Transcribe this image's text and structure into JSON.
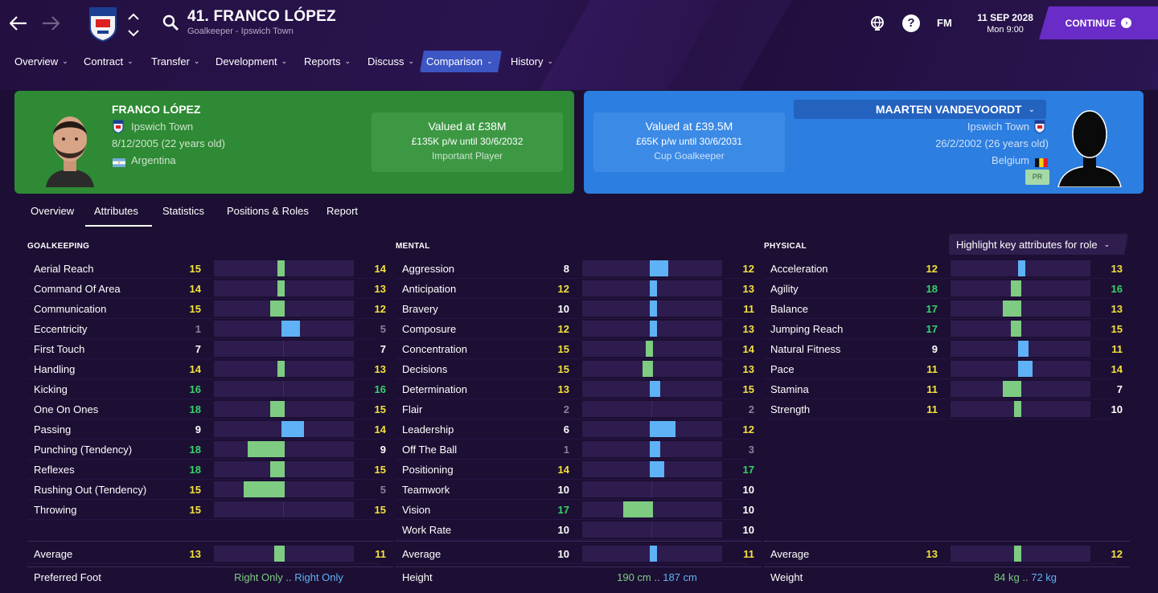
{
  "header": {
    "title": "41. FRANCO LÓPEZ",
    "subtitle": "Goalkeeper - Ipswich Town",
    "fm_label": "FM",
    "date": "11 SEP 2028",
    "time": "Mon 9:00",
    "continue_label": "CONTINUE"
  },
  "menu": [
    {
      "label": "Overview"
    },
    {
      "label": "Contract"
    },
    {
      "label": "Transfer"
    },
    {
      "label": "Development"
    },
    {
      "label": "Reports"
    },
    {
      "label": "Discuss"
    },
    {
      "label": "Comparison",
      "active": true
    },
    {
      "label": "History"
    }
  ],
  "player_left": {
    "name": "FRANCO LÓPEZ",
    "club": "Ipswich Town",
    "dob": "8/12/2005 (22 years old)",
    "nation": "Argentina",
    "valued": "Valued at £38M",
    "wage": "£135K p/w until 30/6/2032",
    "status": "Important Player",
    "card_color": "#2e8a34"
  },
  "player_right": {
    "name": "MAARTEN VANDEVOORDT",
    "club": "Ipswich Town",
    "dob": "26/2/2002 (26 years old)",
    "nation": "Belgium",
    "badge": "PR",
    "valued": "Valued at £39.5M",
    "wage": "£65K p/w until 30/6/2031",
    "status": "Cup Goalkeeper",
    "card_color": "#2c7ee0"
  },
  "subtabs": [
    {
      "label": "Overview"
    },
    {
      "label": "Attributes",
      "active": true
    },
    {
      "label": "Statistics"
    },
    {
      "label": "Positions & Roles"
    },
    {
      "label": "Report"
    }
  ],
  "highlight_label": "Highlight key attributes for role",
  "colors": {
    "left_better": "#7ecb82",
    "right_better": "#5eb2f5",
    "rating_gray": "#8a8199",
    "rating_white": "#ffffff",
    "rating_yellow": "#f3e23b",
    "rating_green": "#37d36a"
  },
  "sections": [
    {
      "title": "GOALKEEPING",
      "attributes": [
        {
          "name": "Aerial Reach",
          "a": 15,
          "b": 14
        },
        {
          "name": "Command Of Area",
          "a": 14,
          "b": 13
        },
        {
          "name": "Communication",
          "a": 15,
          "b": 12
        },
        {
          "name": "Eccentricity",
          "a": 1,
          "b": 5
        },
        {
          "name": "First Touch",
          "a": 7,
          "b": 7
        },
        {
          "name": "Handling",
          "a": 14,
          "b": 13
        },
        {
          "name": "Kicking",
          "a": 16,
          "b": 16
        },
        {
          "name": "One On Ones",
          "a": 18,
          "b": 15
        },
        {
          "name": "Passing",
          "a": 9,
          "b": 14
        },
        {
          "name": "Punching (Tendency)",
          "a": 18,
          "b": 9
        },
        {
          "name": "Reflexes",
          "a": 18,
          "b": 15
        },
        {
          "name": "Rushing Out (Tendency)",
          "a": 15,
          "b": 5
        },
        {
          "name": "Throwing",
          "a": 15,
          "b": 15
        }
      ],
      "average": {
        "name": "Average",
        "a": 13,
        "b": 11
      },
      "footer": {
        "label": "Preferred Foot",
        "a": "Right Only",
        "b": "Right Only"
      }
    },
    {
      "title": "MENTAL",
      "attributes": [
        {
          "name": "Aggression",
          "a": 8,
          "b": 12
        },
        {
          "name": "Anticipation",
          "a": 12,
          "b": 13
        },
        {
          "name": "Bravery",
          "a": 10,
          "b": 11
        },
        {
          "name": "Composure",
          "a": 12,
          "b": 13
        },
        {
          "name": "Concentration",
          "a": 15,
          "b": 14
        },
        {
          "name": "Decisions",
          "a": 15,
          "b": 13
        },
        {
          "name": "Determination",
          "a": 13,
          "b": 15
        },
        {
          "name": "Flair",
          "a": 2,
          "b": 2
        },
        {
          "name": "Leadership",
          "a": 6,
          "b": 12
        },
        {
          "name": "Off The Ball",
          "a": 1,
          "b": 3
        },
        {
          "name": "Positioning",
          "a": 14,
          "b": 17
        },
        {
          "name": "Teamwork",
          "a": 10,
          "b": 10
        },
        {
          "name": "Vision",
          "a": 17,
          "b": 10
        },
        {
          "name": "Work Rate",
          "a": 10,
          "b": 10
        }
      ],
      "average": {
        "name": "Average",
        "a": 10,
        "b": 11
      },
      "footer": {
        "label": "Height",
        "a": "190 cm",
        "b": "187 cm"
      }
    },
    {
      "title": "PHYSICAL",
      "attributes": [
        {
          "name": "Acceleration",
          "a": 12,
          "b": 13
        },
        {
          "name": "Agility",
          "a": 18,
          "b": 16
        },
        {
          "name": "Balance",
          "a": 17,
          "b": 13
        },
        {
          "name": "Jumping Reach",
          "a": 17,
          "b": 15
        },
        {
          "name": "Natural Fitness",
          "a": 9,
          "b": 11
        },
        {
          "name": "Pace",
          "a": 11,
          "b": 14
        },
        {
          "name": "Stamina",
          "a": 11,
          "b": 7
        },
        {
          "name": "Strength",
          "a": 11,
          "b": 10
        }
      ],
      "average": {
        "name": "Average",
        "a": 13,
        "b": 12
      },
      "footer": {
        "label": "Weight",
        "a": "84 kg",
        "b": "72 kg"
      }
    }
  ]
}
